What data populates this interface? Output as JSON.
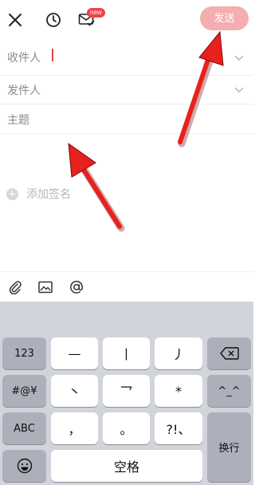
{
  "header": {
    "new_badge": "new",
    "send_label": "发送"
  },
  "form": {
    "recipient_label": "收件人",
    "sender_label": "发件人",
    "subject_label": "主题"
  },
  "signature": {
    "plus": "+",
    "label": "添加签名"
  },
  "keyboard": {
    "row1": [
      "123",
      "—",
      "丨",
      "丿"
    ],
    "row2": [
      "#@¥",
      "丶",
      "乛",
      "*",
      "^_^"
    ],
    "row3": [
      "ABC",
      "，",
      "。",
      "?!、"
    ],
    "row4": [
      "空格",
      "换行"
    ]
  },
  "colors": {
    "accent": "#f2424a",
    "send_button_disabled": "#f4aeb0",
    "annotation_arrow": "#e8211e"
  }
}
